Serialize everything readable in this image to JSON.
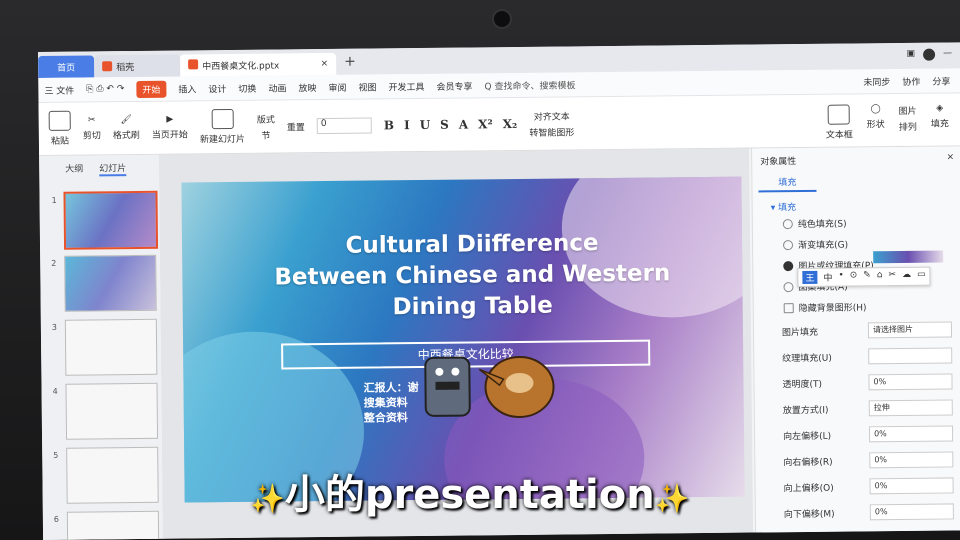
{
  "titlebar": {
    "tabs": [
      {
        "label": "首页"
      },
      {
        "label": "稻壳"
      },
      {
        "label": "中西餐桌文化.pptx"
      }
    ],
    "new_tab": "+"
  },
  "menubar": {
    "file": "三 文件",
    "start": "开始",
    "items": [
      "插入",
      "设计",
      "切换",
      "动画",
      "放映",
      "审阅",
      "视图",
      "开发工具",
      "会员专享"
    ],
    "search": "Q 查找命令、搜索模板",
    "sync": "未同步",
    "collab": "协作",
    "share": "分享"
  },
  "ribbon": {
    "paste": "粘贴",
    "cut": "剪切",
    "format_painter": "格式刷",
    "from_current": "当页开始",
    "new_slide": "新建幻灯片",
    "layout": "版式",
    "section": "节",
    "reset": "重置",
    "font_size": "0",
    "format_buttons": [
      "B",
      "I",
      "U",
      "S",
      "A",
      "X²",
      "X₂"
    ],
    "align_text": "对齐文本",
    "convert_smartart": "转智能图形",
    "textbox": "文本框",
    "shape": "形状",
    "arrange": "排列",
    "picture": "图片",
    "fill": "填充"
  },
  "left_pane": {
    "tab_outline": "大纲",
    "tab_slides": "幻灯片",
    "slide_numbers": [
      "1",
      "2",
      "3",
      "4",
      "5",
      "6"
    ]
  },
  "slide": {
    "title_line1": "Cultural Diifference",
    "title_line2": "Between Chinese and Western",
    "title_line3": "Dining Table",
    "subtitle": "中西餐桌文化比较",
    "reporter_line1": "汇报人：谢",
    "reporter_line2": "搜集资料",
    "reporter_line3": "整合资料"
  },
  "right_pane": {
    "title": "对象属性",
    "fill_tab": "填充",
    "section_fill": "▾ 填充",
    "options": [
      {
        "label": "纯色填充(S)",
        "selected": false
      },
      {
        "label": "渐变填充(G)",
        "selected": false
      },
      {
        "label": "图片或纹理填充(P)",
        "selected": true
      },
      {
        "label": "图案填充(A)",
        "selected": false
      }
    ],
    "hide_bg": "隐藏背景图形(H)",
    "picture_fill_label": "图片填充",
    "picture_fill_value": "请选择图片",
    "texture_fill_label": "纹理填充(U)",
    "transparency_label": "透明度(T)",
    "transparency_value": "0%",
    "placement_label": "放置方式(I)",
    "placement_value": "拉伸",
    "offsets": [
      {
        "label": "向左偏移(L)",
        "value": "0%"
      },
      {
        "label": "向右偏移(R)",
        "value": "0%"
      },
      {
        "label": "向上偏移(O)",
        "value": "0%"
      },
      {
        "label": "向下偏移(M)",
        "value": "0%"
      }
    ],
    "ime_bar": [
      "王",
      "中",
      "•",
      "⊙",
      "✎",
      "⌂",
      "✂",
      "☁",
      "▭"
    ]
  },
  "caption": {
    "text": "小的presentation",
    "spark": "✨"
  }
}
